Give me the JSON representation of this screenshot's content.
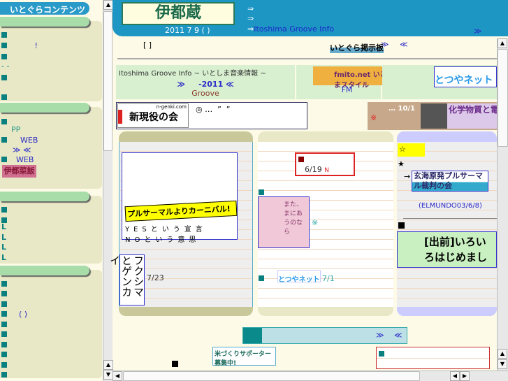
{
  "left": {
    "title": "いとぐらコンテンツ",
    "s1": [
      "",
      "!",
      "",
      "- -",
      "",
      ""
    ],
    "s2": {
      "pp": "PP",
      "web1": "WEB",
      "nav": "≫ ≪",
      "web2": "WEB",
      "banner": "伊都菜飯"
    },
    "s3": [
      "L",
      "L",
      "L",
      "L"
    ],
    "s4_paren": "( )"
  },
  "header": {
    "logo": "伊都蔵",
    "date": "2011 7 9 ( )",
    "arrow1": "⇒",
    "arrow2": "⇒",
    "arrow3": "⇒",
    "link": "Itoshima Groove Info",
    "more": "≫"
  },
  "top": {
    "bracket": "[ ]",
    "bbs": "いとぐら掲示板",
    "bbs_nav_next": "≫",
    "bbs_nav_prev": "≪"
  },
  "banners": {
    "groove_title": "Itoshima Groove Info ~ いとしま音楽情報 ~",
    "groove_nav_next": "≫",
    "groove_year": "-2011",
    "groove_nav_prev": "≪",
    "groove": "Groove",
    "fm_logo": "fmito.net いとしまスタイル",
    "fm": "FM",
    "totsuya": "とつやネット",
    "genki_logo": "新現役の会",
    "genki_site": "n-genki.com",
    "genki_text": "◎ …  ”  ”",
    "brown_text": "… 10/1",
    "brown_mark": "※",
    "chem": "化学物質と電磁 bl"
  },
  "col1": {
    "carnival": "プルサーマルよりカーニバル!",
    "yes": "YESという宣言",
    "no": "NOという意思",
    "fukushima": "フクシマとゲンカイ",
    "date": "7/23"
  },
  "col2": {
    "date": "6/19",
    "n": "N",
    "book": "また、まにあうのなら",
    "mark": "※",
    "totsuya": "とつやネット",
    "date2": "7/1"
  },
  "col3": {
    "star1": "☆",
    "star2": "★",
    "arrow": "→",
    "genkai": "玄海原発プルサーマル裁判の会",
    "elmundo": "(ELMUNDO03/6/8)",
    "demae": "[出前]いろいろはじめました。"
  },
  "bottom": {
    "next": "≫",
    "prev": "≪",
    "supporter": "米づくりサポーター 募集中!"
  }
}
